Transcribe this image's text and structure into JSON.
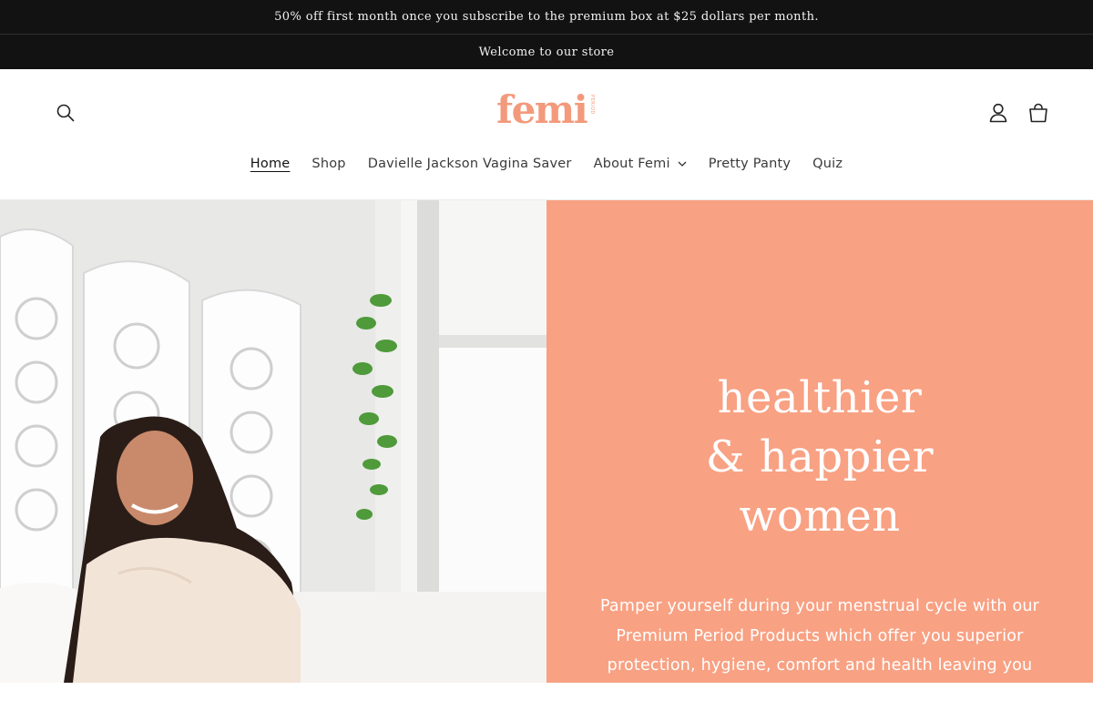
{
  "announcements": [
    "50% off first month once you subscribe to the premium box at $25 dollars per month.",
    "Welcome to our store"
  ],
  "header": {
    "logo_text": "femi",
    "logo_sub": "PERIOD"
  },
  "nav": {
    "items": [
      {
        "label": "Home",
        "active": true
      },
      {
        "label": "Shop"
      },
      {
        "label": "Davielle Jackson Vagina Saver"
      },
      {
        "label": "About Femi",
        "has_dropdown": true
      },
      {
        "label": "Pretty Panty"
      },
      {
        "label": "Quiz"
      }
    ]
  },
  "hero": {
    "title_lines": [
      "healthier",
      "& happier",
      "women"
    ],
    "description": "Pamper yourself during your menstrual cycle with our Premium Period Products which offer you superior protection, hygiene, comfort and health leaving you feeling",
    "panel_color": "#f8a183"
  },
  "icons": {
    "search": "search-icon",
    "account": "account-icon",
    "cart": "cart-icon"
  },
  "colors": {
    "announcement_bg": "#121212",
    "brand": "#f39a7c"
  }
}
